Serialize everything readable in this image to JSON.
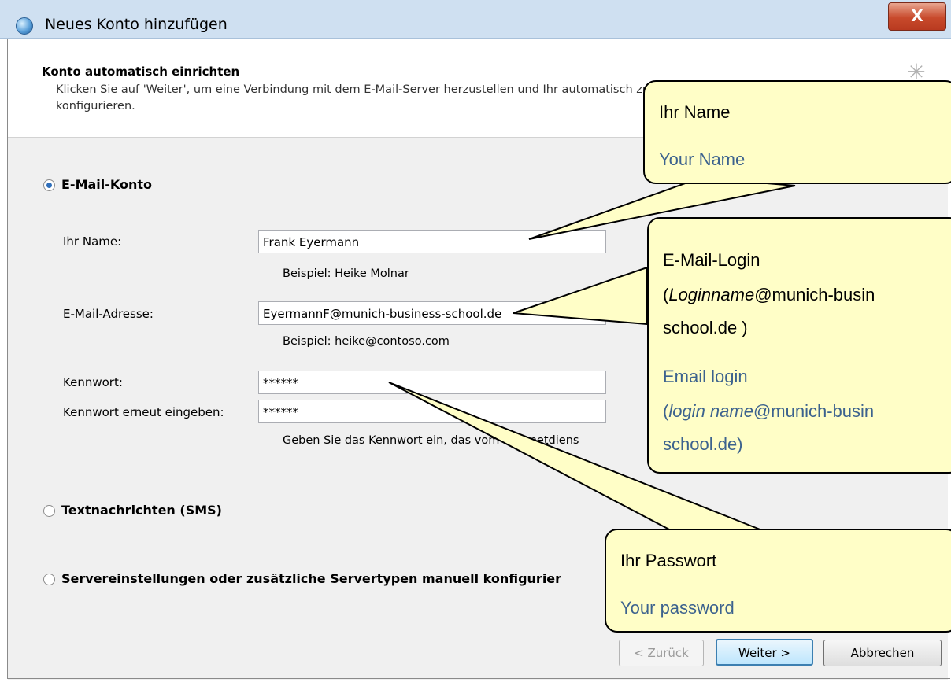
{
  "window": {
    "title": "Neues Konto hinzufügen",
    "close_glyph": "X"
  },
  "header": {
    "title": "Konto automatisch einrichten",
    "description": "Klicken Sie auf 'Weiter', um eine Verbindung mit dem E-Mail-Server herzustellen und Ihr automatisch zu konfigurieren."
  },
  "options": {
    "email_account": {
      "label": "E-Mail-Konto",
      "selected": true
    },
    "sms": {
      "label": "Textnachrichten (SMS)",
      "selected": false
    },
    "manual": {
      "label": "Servereinstellungen oder zusätzliche Servertypen manuell konfigurier",
      "selected": false
    }
  },
  "form": {
    "name_label": "Ihr Name:",
    "name_value": "Frank Eyermann",
    "name_hint": "Beispiel: Heike Molnar",
    "email_label": "E-Mail-Adresse:",
    "email_value": "EyermannF@munich-business-school.de",
    "email_hint": "Beispiel: heike@contoso.com",
    "password_label": "Kennwort:",
    "password_value": "******",
    "password_repeat_label": "Kennwort erneut eingeben:",
    "password_repeat_value": "******",
    "password_hint": "Geben Sie das Kennwort ein, das vom Internetdiens"
  },
  "buttons": {
    "back": "< Zurück",
    "next": "Weiter >",
    "cancel": "Abbrechen"
  },
  "callouts": {
    "name": {
      "de": "Ihr Name",
      "en": "Your Name"
    },
    "email": {
      "de_line1": "E-Mail-Login",
      "de_line2_italic": "Loginname",
      "de_line2_rest": "@munich-busin",
      "de_line3": "school.de )",
      "en_line1": "Email login",
      "en_line2_italic": "login name",
      "en_line2_rest": "@munich-busin",
      "en_line3": "school.de)"
    },
    "password": {
      "de": "Ihr Passwort",
      "en": "Your password"
    }
  },
  "colors": {
    "callout_fill": "#fffec7",
    "callout_blue_text": "#3c628e",
    "titlebar": "#cfe0f1"
  }
}
